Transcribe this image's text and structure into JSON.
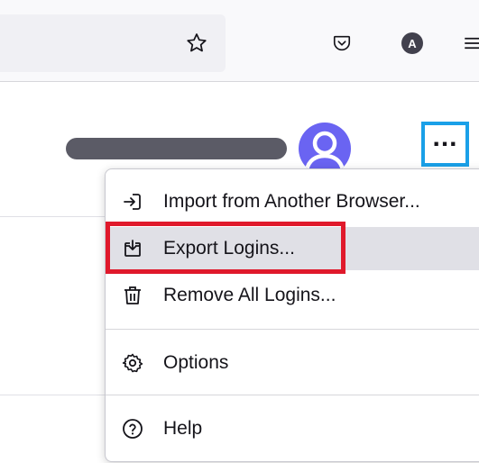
{
  "toolbar": {
    "bookmark_icon": "star-icon",
    "pocket_icon": "pocket-icon",
    "account_initial": "A",
    "menu_icon": "hamburger-icon"
  },
  "header": {
    "username_redacted": true,
    "menu_button_label": "..."
  },
  "menu": {
    "items": [
      {
        "label": "Import from Another Browser...",
        "icon": "import-icon"
      },
      {
        "label": "Export Logins...",
        "icon": "export-icon"
      },
      {
        "label": "Remove All Logins...",
        "icon": "trash-icon"
      },
      {
        "label": "Options",
        "icon": "gear-icon"
      },
      {
        "label": "Help",
        "icon": "help-icon"
      }
    ]
  },
  "colors": {
    "highlight_blue": "#1aa0e8",
    "highlight_red": "#e0192b",
    "avatar": "#6a64f2"
  }
}
